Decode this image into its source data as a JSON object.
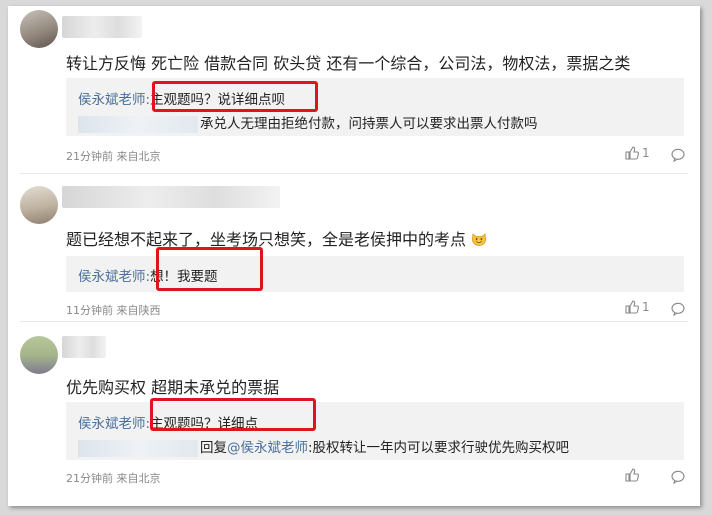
{
  "comments": [
    {
      "body": "转让方反悔 死亡险 借款合同 砍头贷 还有一个综合，公司法，物权法，票据之类",
      "reply": {
        "author": "侯永斌老师:",
        "text": "主观题吗？说详细点呗",
        "quoted": "承兑人无理由拒绝付款，问持票人可以要求出票人付款吗"
      },
      "meta": "21分钟前 来自北京",
      "likes": "1"
    },
    {
      "body": "题已经想不起来了，坐考场只想笑，全是老侯押中的考点",
      "reply": {
        "author": "侯永斌老师:",
        "text": "想！我要题"
      },
      "meta": "11分钟前 来自陕西",
      "likes": "1"
    },
    {
      "body": "优先购买权 超期未承兑的票据",
      "reply": {
        "author": "侯永斌老师:",
        "text": "主观题吗？详细点",
        "quoted_prefix": "回复",
        "quoted_mention": "@侯永斌老师",
        "quoted_text": ":股权转让一年内可以要求行驶优先购买权吧"
      },
      "meta": "21分钟前 来自北京",
      "likes": ""
    }
  ],
  "colors": {
    "highlight_box": "#e0141e",
    "author_link": "#4a6f9c",
    "reply_bg": "#f2f2f2"
  },
  "icons": [
    "thumbs-up-icon",
    "comment-reply-icon",
    "grinning-cat-emoji"
  ]
}
